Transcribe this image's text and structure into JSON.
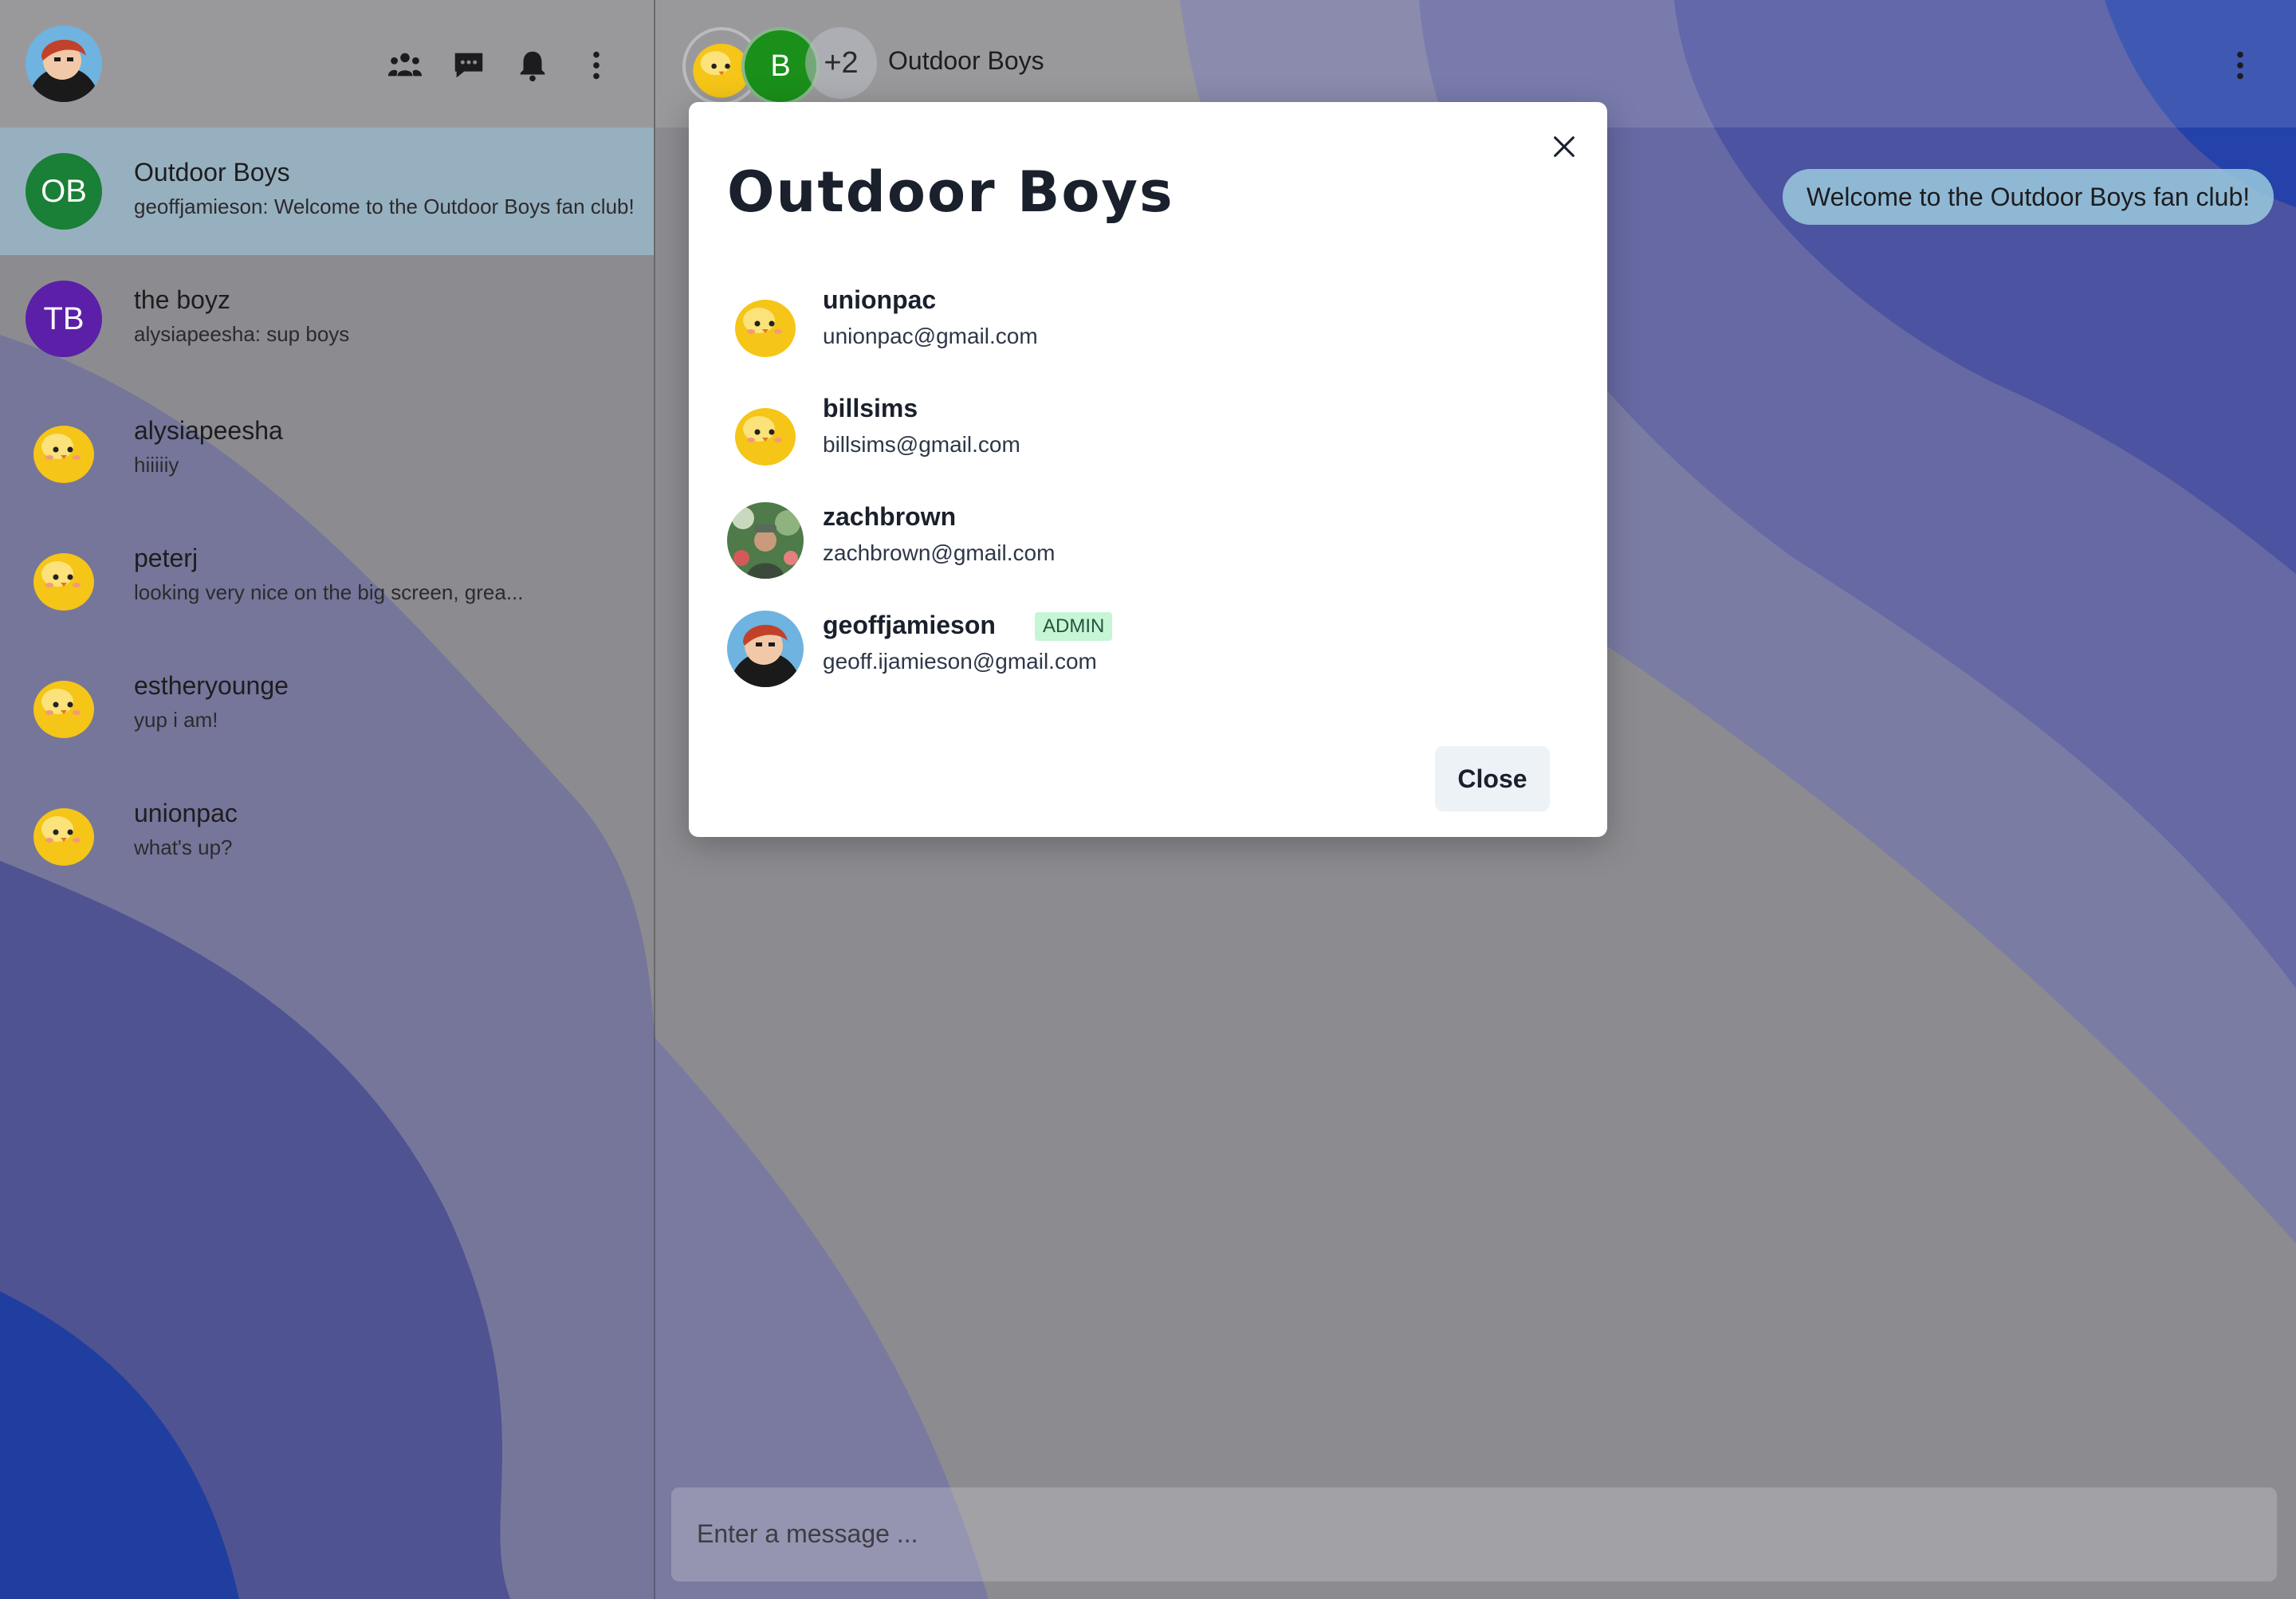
{
  "sidebar": {
    "icons": [
      "people-icon",
      "chat-bubble-icon",
      "bell-icon",
      "more-vertical-icon"
    ],
    "chats": [
      {
        "name": "Outdoor Boys",
        "last_message": "geoffjamieson: Welcome to the Outdoor Boys fan club!",
        "avatar_text": "OB",
        "avatar_color": "#1a7f37",
        "active": true
      },
      {
        "name": "the boyz",
        "last_message": "alysiapeesha: sup boys",
        "avatar_text": "TB",
        "avatar_color": "#5b1fa8",
        "active": false
      },
      {
        "name": "alysiapeesha",
        "last_message": "hiiiiiy",
        "avatar_text": "",
        "active": false
      },
      {
        "name": "peterj",
        "last_message": "looking very nice on the big screen, grea...",
        "avatar_text": "",
        "active": false
      },
      {
        "name": "estheryounge",
        "last_message": "yup i am!",
        "avatar_text": "",
        "active": false
      },
      {
        "name": "unionpac",
        "last_message": "what's up?",
        "avatar_text": "",
        "active": false
      }
    ]
  },
  "header": {
    "group_title": "Outdoor Boys",
    "member_initial": "B",
    "member_initial_color": "#1a8f1a",
    "extra_members": "+2"
  },
  "messages": [
    {
      "text": "Welcome to the Outdoor Boys fan club!"
    }
  ],
  "composer": {
    "placeholder": "Enter a message ..."
  },
  "modal": {
    "title": "Outdoor Boys",
    "members": [
      {
        "username": "unionpac",
        "email": "unionpac@gmail.com",
        "avatar": "chick",
        "admin": false
      },
      {
        "username": "billsims",
        "email": "billsims@gmail.com",
        "avatar": "chick",
        "admin": false
      },
      {
        "username": "zachbrown",
        "email": "zachbrown@gmail.com",
        "avatar": "photo",
        "admin": false
      },
      {
        "username": "geoffjamieson",
        "email": "geoff.ijamieson@gmail.com",
        "avatar": "cartoon",
        "admin": true
      }
    ],
    "admin_label": "ADMIN",
    "close_label": "Close"
  },
  "colors": {
    "active_chat": "#a0cde6",
    "badge_bg": "#c6f6d5",
    "badge_text": "#22543d"
  }
}
